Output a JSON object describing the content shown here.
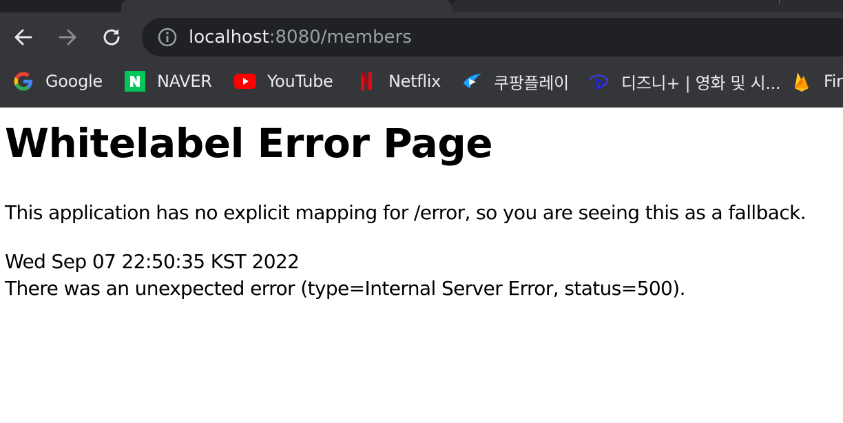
{
  "browser": {
    "url": {
      "host": "localhost",
      "path": ":8080/members"
    },
    "nav": {
      "back_icon": "arrow-left-icon",
      "forward_icon": "arrow-right-icon",
      "reload_icon": "reload-icon",
      "site_info_icon": "info-circle-icon"
    },
    "bookmarks": [
      {
        "label": "Google",
        "icon": "google-icon"
      },
      {
        "label": "NAVER",
        "icon": "naver-icon"
      },
      {
        "label": "YouTube",
        "icon": "youtube-icon"
      },
      {
        "label": "Netflix",
        "icon": "netflix-icon"
      },
      {
        "label": "쿠팡플레이",
        "icon": "coupang-play-icon"
      },
      {
        "label": "디즈니+ | 영화 및 시...",
        "icon": "disney-plus-icon"
      },
      {
        "label": "Fir",
        "icon": "firebase-icon"
      }
    ]
  },
  "page": {
    "title": "Whitelabel Error Page",
    "message": "This application has no explicit mapping for /error, so you are seeing this as a fallback.",
    "timestamp": "Wed Sep 07 22:50:35 KST 2022",
    "error_detail": "There was an unexpected error (type=Internal Server Error, status=500)."
  },
  "colors": {
    "chrome_bg": "#35363a",
    "omnibox_bg": "#202124",
    "url_host": "#e8eaed",
    "url_path": "#9aa0a6"
  }
}
